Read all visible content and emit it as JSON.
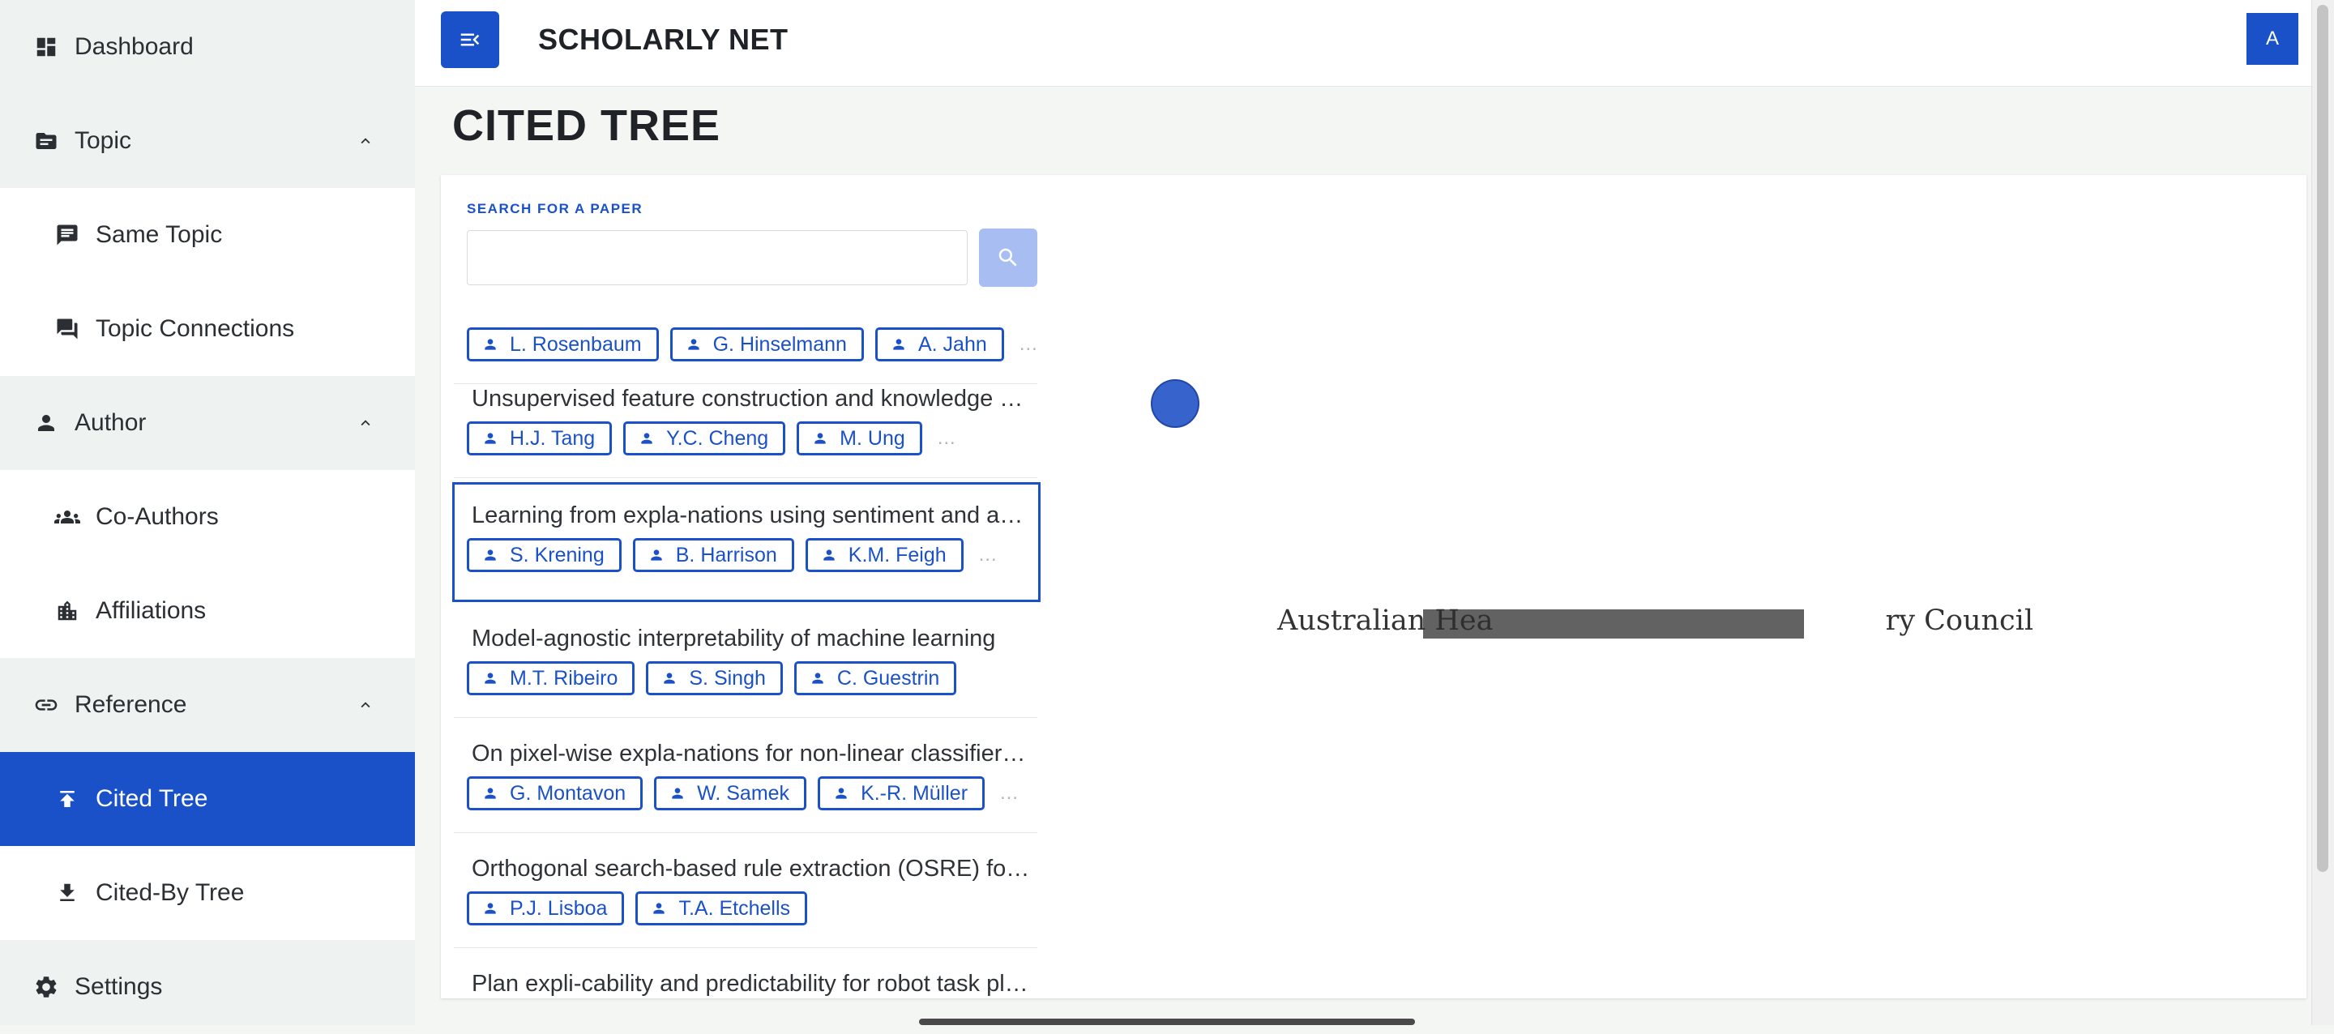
{
  "sidebar": {
    "items": [
      {
        "label": "Dashboard",
        "icon": "dashboard-icon"
      },
      {
        "label": "Topic",
        "icon": "topic-icon",
        "expanded": true
      },
      {
        "label": "Same Topic",
        "icon": "chat-icon"
      },
      {
        "label": "Topic Connections",
        "icon": "forum-icon"
      },
      {
        "label": "Author",
        "icon": "person-icon",
        "expanded": true
      },
      {
        "label": "Co-Authors",
        "icon": "group-icon"
      },
      {
        "label": "Affiliations",
        "icon": "building-icon"
      },
      {
        "label": "Reference",
        "icon": "link-icon",
        "expanded": true
      },
      {
        "label": "Cited Tree",
        "icon": "upload-icon",
        "active": true
      },
      {
        "label": "Cited-By Tree",
        "icon": "download-icon"
      },
      {
        "label": "Settings",
        "icon": "gear-icon"
      }
    ]
  },
  "header": {
    "title": "SCHOLARLY NET",
    "avatar": "A"
  },
  "page": {
    "title": "CITED TREE"
  },
  "search": {
    "label": "SEARCH FOR A PAPER",
    "value": "",
    "placeholder": ""
  },
  "papers": [
    {
      "title": "",
      "authors": [
        "L. Rosenbaum",
        "G. Hinselmann",
        "A. Jahn"
      ],
      "more": "…"
    },
    {
      "title": "Unsupervised feature construction and knowledge extraction from genome-wide assays",
      "authors": [
        "H.J. Tang",
        "Y.C. Cheng",
        "M. Ung"
      ],
      "more": "…"
    },
    {
      "title": "Learning from expla-nations using sentiment and advice in RL",
      "authors": [
        "S. Krening",
        "B. Harrison",
        "K.M. Feigh"
      ],
      "more": "…",
      "selected": true
    },
    {
      "title": "Model-agnostic interpretability of machine learning",
      "authors": [
        "M.T. Ribeiro",
        "S. Singh",
        "C. Guestrin"
      ],
      "more": ""
    },
    {
      "title": "On pixel-wise expla-nations for non-linear classifier decisions by layer-wise relevance propagation",
      "authors": [
        "G. Montavon",
        "W. Samek",
        "K.-R. Müller"
      ],
      "more": "…"
    },
    {
      "title": "Orthogonal search-based rule extraction (OSRE) for trained neural networks",
      "authors": [
        "P.J. Lisboa",
        "T.A. Etchells"
      ],
      "more": ""
    },
    {
      "title": "Plan expli-cability and predictability for robot task planning",
      "authors": [],
      "more": ""
    }
  ],
  "tree": {
    "label_start": "Australian Hea",
    "label_end": "ry Council",
    "node_color": "#3663cc"
  },
  "colors": {
    "accent": "#1a51c8",
    "sidebar_bg": "#eef3f2"
  }
}
